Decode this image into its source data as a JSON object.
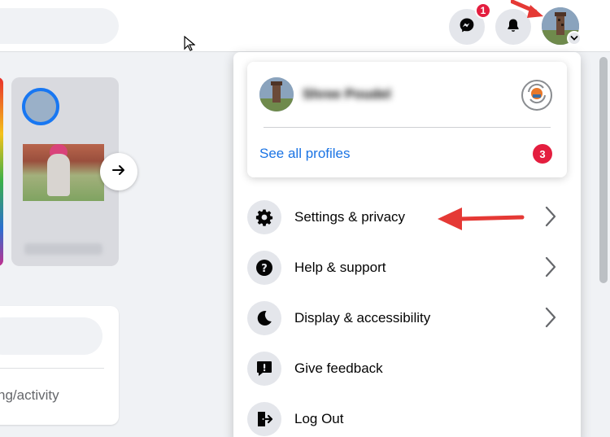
{
  "topbar": {
    "messenger_badge": "1"
  },
  "left": {
    "composer_text": "eling/activity"
  },
  "menu": {
    "profile_name": "Shree Poudel",
    "see_all_profiles": "See all profiles",
    "see_all_badge": "3",
    "items": [
      {
        "label": "Settings & privacy",
        "icon": "gear-icon",
        "has_chevron": true
      },
      {
        "label": "Help & support",
        "icon": "help-icon",
        "has_chevron": true
      },
      {
        "label": "Display & accessibility",
        "icon": "moon-icon",
        "has_chevron": true
      },
      {
        "label": "Give feedback",
        "icon": "feedback-icon",
        "has_chevron": false
      },
      {
        "label": "Log Out",
        "icon": "logout-icon",
        "has_chevron": false
      }
    ]
  },
  "colors": {
    "accent_blue": "#1b74e4",
    "badge_red": "#e41e3f",
    "annotation_red": "#e53935"
  }
}
